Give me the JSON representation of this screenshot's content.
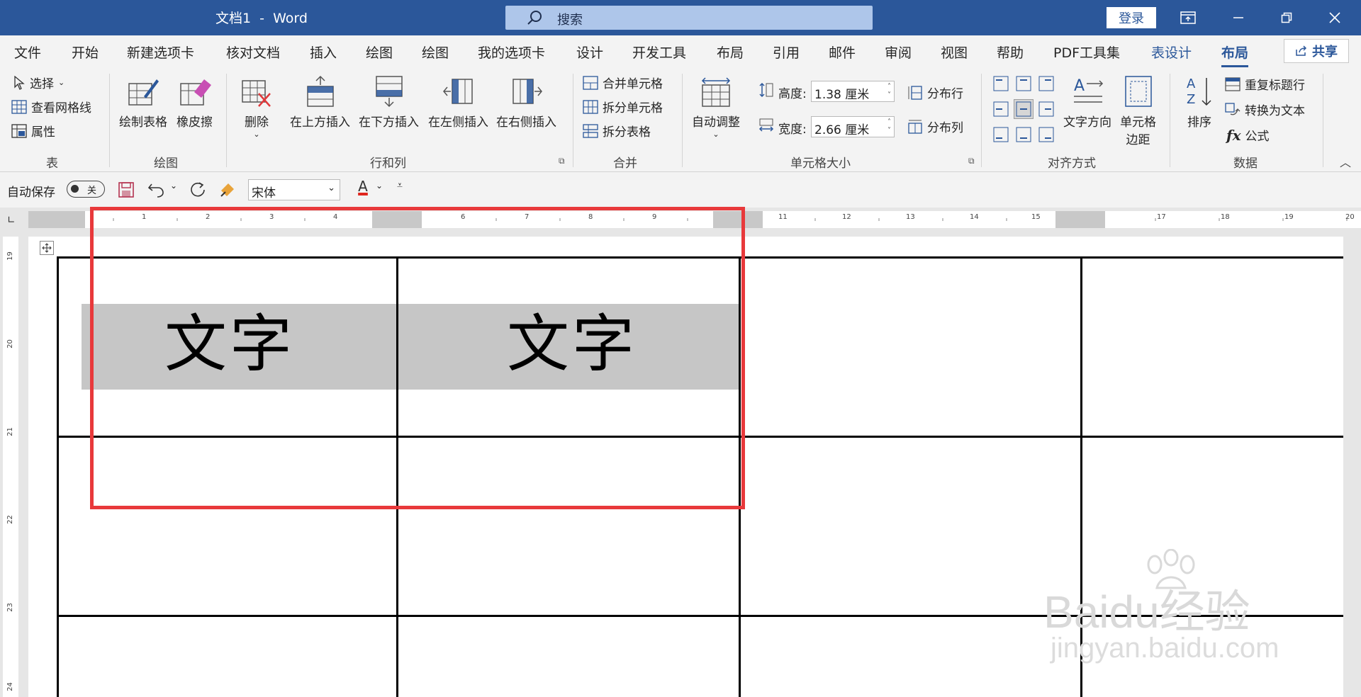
{
  "window": {
    "title": "文档1  -  Word",
    "search_placeholder": "搜索",
    "login_label": "登录"
  },
  "tabs": [
    {
      "label": "文件"
    },
    {
      "label": "开始"
    },
    {
      "label": "新建选项卡"
    },
    {
      "label": "核对文档"
    },
    {
      "label": "插入"
    },
    {
      "label": "绘图"
    },
    {
      "label": "绘图"
    },
    {
      "label": "我的选项卡"
    },
    {
      "label": "设计"
    },
    {
      "label": "开发工具"
    },
    {
      "label": "布局"
    },
    {
      "label": "引用"
    },
    {
      "label": "邮件"
    },
    {
      "label": "审阅"
    },
    {
      "label": "视图"
    },
    {
      "label": "帮助"
    },
    {
      "label": "PDF工具集"
    },
    {
      "label": "表设计"
    },
    {
      "label": "布局"
    }
  ],
  "share_label": "共享",
  "ribbon": {
    "table": {
      "select": "选择",
      "gridlines": "查看网格线",
      "properties": "属性",
      "label": "表"
    },
    "draw": {
      "draw_table": "绘制表格",
      "eraser": "橡皮擦",
      "label": "绘图"
    },
    "rows_cols": {
      "delete": "删除",
      "insert_above": "在上方插入",
      "insert_below": "在下方插入",
      "insert_left": "在左侧插入",
      "insert_right": "在右侧插入",
      "label": "行和列"
    },
    "merge": {
      "merge_cells": "合并单元格",
      "split_cells": "拆分单元格",
      "split_table": "拆分表格",
      "label": "合并"
    },
    "cell_size": {
      "autofit": "自动调整",
      "height_label": "高度:",
      "height_value": "1.38 厘米",
      "width_label": "宽度:",
      "width_value": "2.66 厘米",
      "distribute_rows": "分布行",
      "distribute_cols": "分布列",
      "label": "单元格大小"
    },
    "alignment": {
      "text_direction": "文字方向",
      "cell_margins_1": "单元格",
      "cell_margins_2": "边距",
      "label": "对齐方式"
    },
    "data": {
      "sort": "排序",
      "repeat_header": "重复标题行",
      "convert_text": "转换为文本",
      "formula": "公式",
      "formula_fx": "fx",
      "label": "数据"
    }
  },
  "qat": {
    "autosave": "自动保存",
    "autosave_state": "关",
    "font": "宋体",
    "font_color_glyph": "A"
  },
  "ruler_h": [
    "1",
    "2",
    "3",
    "4",
    "6",
    "7",
    "8",
    "9",
    "11",
    "12",
    "13",
    "14",
    "15",
    "17",
    "18",
    "19",
    "20"
  ],
  "ruler_v": [
    "19",
    "20",
    "21",
    "22",
    "23",
    "24"
  ],
  "document": {
    "cell_1": "文字",
    "cell_2": "文字"
  },
  "watermark": {
    "brand": "Baidu经验",
    "url": "jingyan.baidu.com"
  },
  "colors": {
    "accent": "#2b579a",
    "highlight_box": "#e8393b",
    "cell_shading": "#c6c6c6"
  }
}
